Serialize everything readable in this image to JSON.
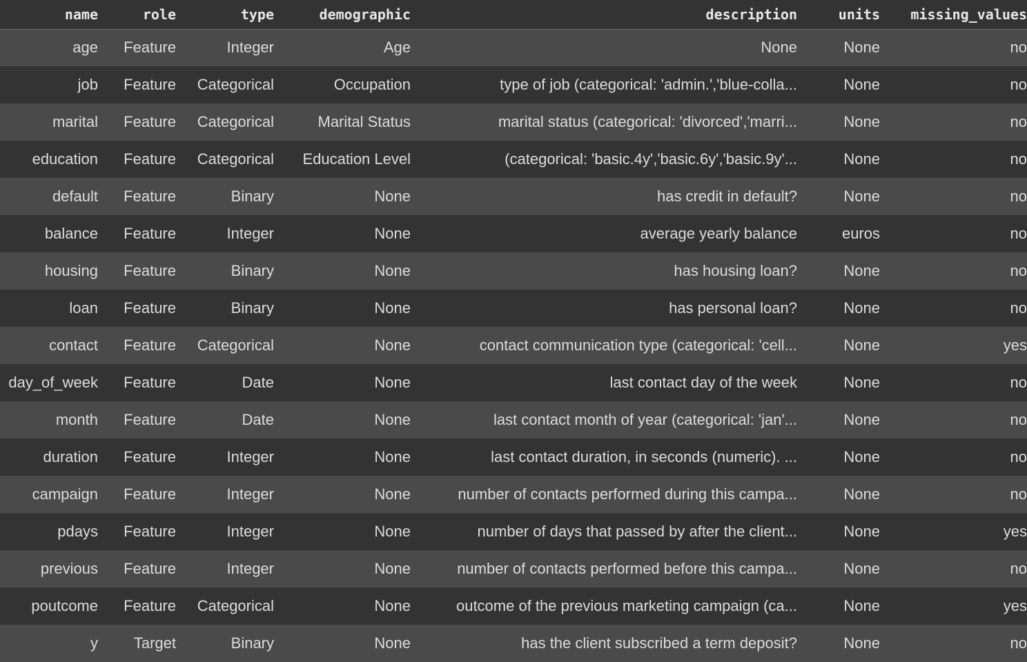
{
  "table": {
    "columns": [
      {
        "key": "name",
        "label": "name",
        "align": "right"
      },
      {
        "key": "role",
        "label": "role",
        "align": "right"
      },
      {
        "key": "type",
        "label": "type",
        "align": "right"
      },
      {
        "key": "demographic",
        "label": "demographic",
        "align": "right"
      },
      {
        "key": "description",
        "label": "description",
        "align": "right"
      },
      {
        "key": "units",
        "label": "units",
        "align": "left"
      },
      {
        "key": "missing_values",
        "label": "missing_values",
        "align": "right"
      }
    ],
    "headers": {
      "name": "name",
      "role": "role",
      "type": "type",
      "demographic": "demographic",
      "description": "description",
      "units": "units",
      "missing_values": "missing_values"
    },
    "rows": [
      {
        "name": "age",
        "role": "Feature",
        "type": "Integer",
        "demographic": "Age",
        "description": "None",
        "units": "None",
        "missing_values": "no"
      },
      {
        "name": "job",
        "role": "Feature",
        "type": "Categorical",
        "demographic": "Occupation",
        "description": "type of job (categorical: 'admin.','blue-colla...",
        "units": "None",
        "missing_values": "no"
      },
      {
        "name": "marital",
        "role": "Feature",
        "type": "Categorical",
        "demographic": "Marital Status",
        "description": "marital status (categorical: 'divorced','marri...",
        "units": "None",
        "missing_values": "no"
      },
      {
        "name": "education",
        "role": "Feature",
        "type": "Categorical",
        "demographic": "Education Level",
        "description": "(categorical: 'basic.4y','basic.6y','basic.9y'...",
        "units": "None",
        "missing_values": "no"
      },
      {
        "name": "default",
        "role": "Feature",
        "type": "Binary",
        "demographic": "None",
        "description": "has credit in default?",
        "units": "None",
        "missing_values": "no"
      },
      {
        "name": "balance",
        "role": "Feature",
        "type": "Integer",
        "demographic": "None",
        "description": "average yearly balance",
        "units": "euros",
        "missing_values": "no"
      },
      {
        "name": "housing",
        "role": "Feature",
        "type": "Binary",
        "demographic": "None",
        "description": "has housing loan?",
        "units": "None",
        "missing_values": "no"
      },
      {
        "name": "loan",
        "role": "Feature",
        "type": "Binary",
        "demographic": "None",
        "description": "has personal loan?",
        "units": "None",
        "missing_values": "no"
      },
      {
        "name": "contact",
        "role": "Feature",
        "type": "Categorical",
        "demographic": "None",
        "description": "contact communication type (categorical: 'cell...",
        "units": "None",
        "missing_values": "yes"
      },
      {
        "name": "day_of_week",
        "role": "Feature",
        "type": "Date",
        "demographic": "None",
        "description": "last contact day of the week",
        "units": "None",
        "missing_values": "no"
      },
      {
        "name": "month",
        "role": "Feature",
        "type": "Date",
        "demographic": "None",
        "description": "last contact month of year (categorical: 'jan'...",
        "units": "None",
        "missing_values": "no"
      },
      {
        "name": "duration",
        "role": "Feature",
        "type": "Integer",
        "demographic": "None",
        "description": "last contact duration, in seconds (numeric). ...",
        "units": "None",
        "missing_values": "no"
      },
      {
        "name": "campaign",
        "role": "Feature",
        "type": "Integer",
        "demographic": "None",
        "description": "number of contacts performed during this campa...",
        "units": "None",
        "missing_values": "no"
      },
      {
        "name": "pdays",
        "role": "Feature",
        "type": "Integer",
        "demographic": "None",
        "description": "number of days that passed by after the client...",
        "units": "None",
        "missing_values": "yes"
      },
      {
        "name": "previous",
        "role": "Feature",
        "type": "Integer",
        "demographic": "None",
        "description": "number of contacts performed before this campa...",
        "units": "None",
        "missing_values": "no"
      },
      {
        "name": "poutcome",
        "role": "Feature",
        "type": "Categorical",
        "demographic": "None",
        "description": "outcome of the previous marketing campaign (ca...",
        "units": "None",
        "missing_values": "yes"
      },
      {
        "name": "y",
        "role": "Target",
        "type": "Binary",
        "demographic": "None",
        "description": "has the client subscribed a term deposit?",
        "units": "None",
        "missing_values": "no"
      }
    ]
  },
  "colors": {
    "background": "#333333",
    "row_odd": "#4a4a4a",
    "row_even": "#333333",
    "header_text": "#e8e8e8",
    "body_text": "#dcdcdc",
    "header_rule": "#6a6a6a"
  }
}
